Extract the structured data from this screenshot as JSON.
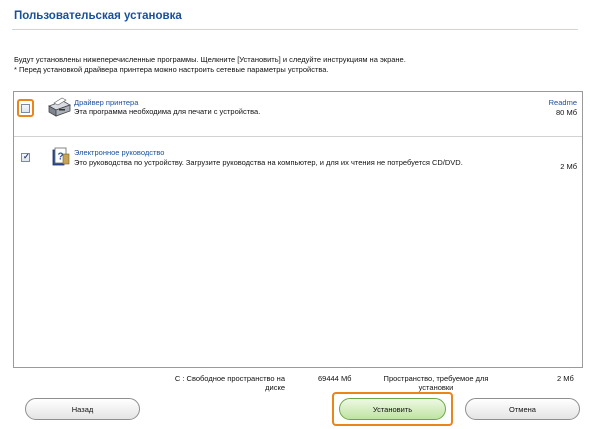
{
  "title": "Пользовательская установка",
  "intro": {
    "line1": "Будут установлены нижеперечисленные программы. Щелкните [Установить] и следуйте инструкциям на экране.",
    "line2": "* Перед установкой драйвера принтера можно настроить сетевые параметры устройства."
  },
  "items": [
    {
      "name": "Драйвер принтера",
      "description": "Эта программа необходима для печати с устройства.",
      "readme": "Readme",
      "size": "80 Мб",
      "checked": false,
      "icon": "printer-driver-icon"
    },
    {
      "name": "Электронное руководство",
      "description": "Это руководства по устройству. Загрузите руководства на компьютер, и для их чтения не потребуется CD/DVD.",
      "size": "2 Мб",
      "checked": true,
      "icon": "manual-help-icon"
    }
  ],
  "space": {
    "free_label_1": "C : Свободное пространство на",
    "free_label_2": "диске",
    "free_value": "69444 Мб",
    "required_label_1": "Пространство, требуемое для",
    "required_label_2": "установки",
    "required_value": "2 Мб"
  },
  "buttons": {
    "back": "Назад",
    "install": "Установить",
    "cancel": "Отмена"
  },
  "colors": {
    "title": "#1a4f9c",
    "highlight": "#e8861a",
    "install_button": "#bfe3a2"
  }
}
